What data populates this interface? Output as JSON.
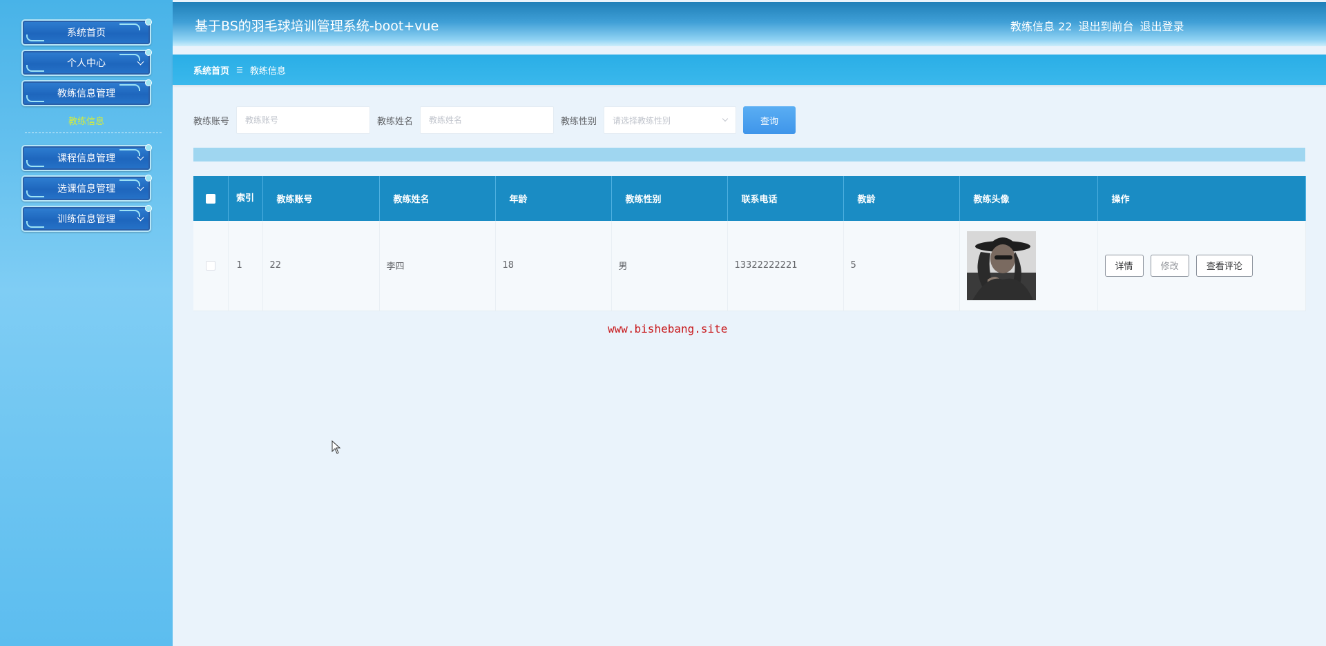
{
  "sidebar": {
    "items": [
      {
        "label": "系统首页"
      },
      {
        "label": "个人中心"
      },
      {
        "label": "教练信息管理"
      },
      {
        "label": "课程信息管理"
      },
      {
        "label": "选课信息管理"
      },
      {
        "label": "训练信息管理"
      }
    ],
    "submenu": {
      "label": "教练信息"
    },
    "colors": {
      "submenu_text": "#d4ec3c",
      "button_bg": "#1e66bd"
    }
  },
  "header": {
    "title": "基于BS的羽毛球培训管理系统-boot+vue",
    "user_info": "教练信息 22",
    "front_link": "退出到前台",
    "logout_link": "退出登录"
  },
  "breadcrumb": {
    "home": "系统首页",
    "separator": "☰",
    "current": "教练信息"
  },
  "search": {
    "account_label": "教练账号",
    "account_placeholder": "教练账号",
    "name_label": "教练姓名",
    "name_placeholder": "教练姓名",
    "gender_label": "教练性别",
    "gender_placeholder": "请选择教练性别",
    "query_button": "查询"
  },
  "table": {
    "headers": {
      "index": "索引",
      "account": "教练账号",
      "name": "教练姓名",
      "age": "年龄",
      "gender": "教练性别",
      "phone": "联系电话",
      "teaching_years": "教龄",
      "avatar": "教练头像",
      "actions": "操作"
    },
    "rows": [
      {
        "index": "1",
        "account": "22",
        "name": "李四",
        "age": "18",
        "gender": "男",
        "phone": "13322222221",
        "teaching_years": "5",
        "avatar": "avatar-photo",
        "actions": {
          "detail": "详情",
          "edit": "修改",
          "reviews": "查看评论"
        }
      }
    ],
    "colors": {
      "header_bg": "#1a8cc4"
    }
  },
  "watermark": "www.bishebang.site"
}
